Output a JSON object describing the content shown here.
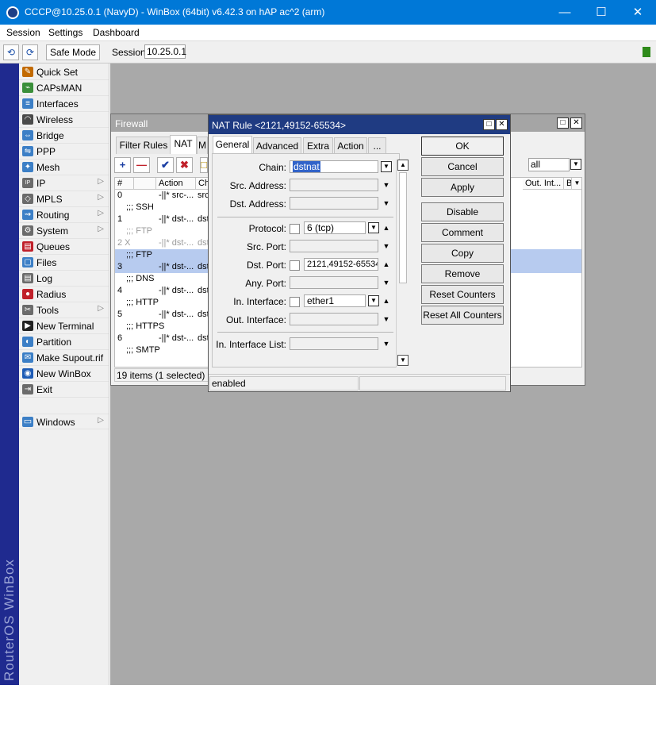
{
  "window": {
    "title": "CCCP@10.25.0.1 (NavyD) - WinBox (64bit) v6.42.3 on hAP ac^2 (arm)"
  },
  "menu": [
    "Session",
    "Settings",
    "Dashboard"
  ],
  "toolbar": {
    "undo": "⟲",
    "redo": "⟳",
    "safe_mode": "Safe Mode",
    "session_label": "Session:",
    "session_value": "10.25.0.1"
  },
  "brand": "RouterOS WinBox",
  "sidebar": [
    {
      "label": "Quick Set",
      "icon": "quick-set-icon",
      "sub": false
    },
    {
      "label": "CAPsMAN",
      "icon": "capsman-icon",
      "sub": false
    },
    {
      "label": "Interfaces",
      "icon": "interfaces-icon",
      "sub": false
    },
    {
      "label": "Wireless",
      "icon": "wireless-icon",
      "sub": false
    },
    {
      "label": "Bridge",
      "icon": "bridge-icon",
      "sub": false
    },
    {
      "label": "PPP",
      "icon": "ppp-icon",
      "sub": false
    },
    {
      "label": "Mesh",
      "icon": "mesh-icon",
      "sub": false
    },
    {
      "label": "IP",
      "icon": "ip-icon",
      "sub": true
    },
    {
      "label": "MPLS",
      "icon": "mpls-icon",
      "sub": true
    },
    {
      "label": "Routing",
      "icon": "routing-icon",
      "sub": true
    },
    {
      "label": "System",
      "icon": "system-icon",
      "sub": true
    },
    {
      "label": "Queues",
      "icon": "queues-icon",
      "sub": false
    },
    {
      "label": "Files",
      "icon": "files-icon",
      "sub": false
    },
    {
      "label": "Log",
      "icon": "log-icon",
      "sub": false
    },
    {
      "label": "Radius",
      "icon": "radius-icon",
      "sub": false
    },
    {
      "label": "Tools",
      "icon": "tools-icon",
      "sub": true
    },
    {
      "label": "New Terminal",
      "icon": "terminal-icon",
      "sub": false
    },
    {
      "label": "Partition",
      "icon": "partition-icon",
      "sub": false
    },
    {
      "label": "Make Supout.rif",
      "icon": "supout-icon",
      "sub": false
    },
    {
      "label": "New WinBox",
      "icon": "winbox-icon",
      "sub": false
    },
    {
      "label": "Exit",
      "icon": "exit-icon",
      "sub": false
    }
  ],
  "sidebar_windows": {
    "label": "Windows",
    "icon": "windows-icon"
  },
  "firewall": {
    "title": "Firewall",
    "tabs": [
      "Filter Rules",
      "NAT",
      "M"
    ],
    "filter_value": "all",
    "headers": [
      "#",
      "Action",
      "Cha",
      "Out. Int...",
      "B"
    ],
    "rows": [
      {
        "type": "rule",
        "num": "0",
        "action": "-||* src-...",
        "chain": "src",
        "state": ""
      },
      {
        "type": "comment",
        "text": ";;; SSH",
        "state": ""
      },
      {
        "type": "rule",
        "num": "1",
        "action": "-||* dst-...",
        "chain": "dst",
        "state": ""
      },
      {
        "type": "comment",
        "text": ";;; FTP",
        "state": "disabled"
      },
      {
        "type": "rule",
        "num": "2 X",
        "action": "-||* dst-...",
        "chain": "dst",
        "state": "disabled"
      },
      {
        "type": "comment",
        "text": ";;; FTP",
        "state": "sel"
      },
      {
        "type": "rule",
        "num": "3",
        "action": "-||* dst-...",
        "chain": "dst",
        "state": "sel"
      },
      {
        "type": "comment",
        "text": ";;; DNS",
        "state": ""
      },
      {
        "type": "rule",
        "num": "4",
        "action": "-||* dst-...",
        "chain": "dst",
        "state": ""
      },
      {
        "type": "comment",
        "text": ";;; HTTP",
        "state": ""
      },
      {
        "type": "rule",
        "num": "5",
        "action": "-||* dst-...",
        "chain": "dst",
        "state": ""
      },
      {
        "type": "comment",
        "text": ";;; HTTPS",
        "state": ""
      },
      {
        "type": "rule",
        "num": "6",
        "action": "-||* dst-...",
        "chain": "dst",
        "state": ""
      },
      {
        "type": "comment",
        "text": ";;; SMTP",
        "state": ""
      }
    ],
    "status": "19 items (1 selected)"
  },
  "nat_rule": {
    "title": "NAT Rule <2121,49152-65534>",
    "tabs": [
      "General",
      "Advanced",
      "Extra",
      "Action",
      "..."
    ],
    "fields": {
      "chain": {
        "label": "Chain:",
        "value": "dstnat"
      },
      "src_address": {
        "label": "Src. Address:",
        "value": ""
      },
      "dst_address": {
        "label": "Dst. Address:",
        "value": ""
      },
      "protocol": {
        "label": "Protocol:",
        "value": "6 (tcp)"
      },
      "src_port": {
        "label": "Src. Port:",
        "value": ""
      },
      "dst_port": {
        "label": "Dst. Port:",
        "value": "2121,49152-65534"
      },
      "any_port": {
        "label": "Any. Port:",
        "value": ""
      },
      "in_interface": {
        "label": "In. Interface:",
        "value": "ether1"
      },
      "out_interface": {
        "label": "Out. Interface:",
        "value": ""
      },
      "in_interface_list": {
        "label": "In. Interface List:",
        "value": ""
      }
    },
    "buttons": [
      "OK",
      "Cancel",
      "Apply",
      "Disable",
      "Comment",
      "Copy",
      "Remove",
      "Reset Counters",
      "Reset All Counters"
    ],
    "status": "enabled"
  }
}
